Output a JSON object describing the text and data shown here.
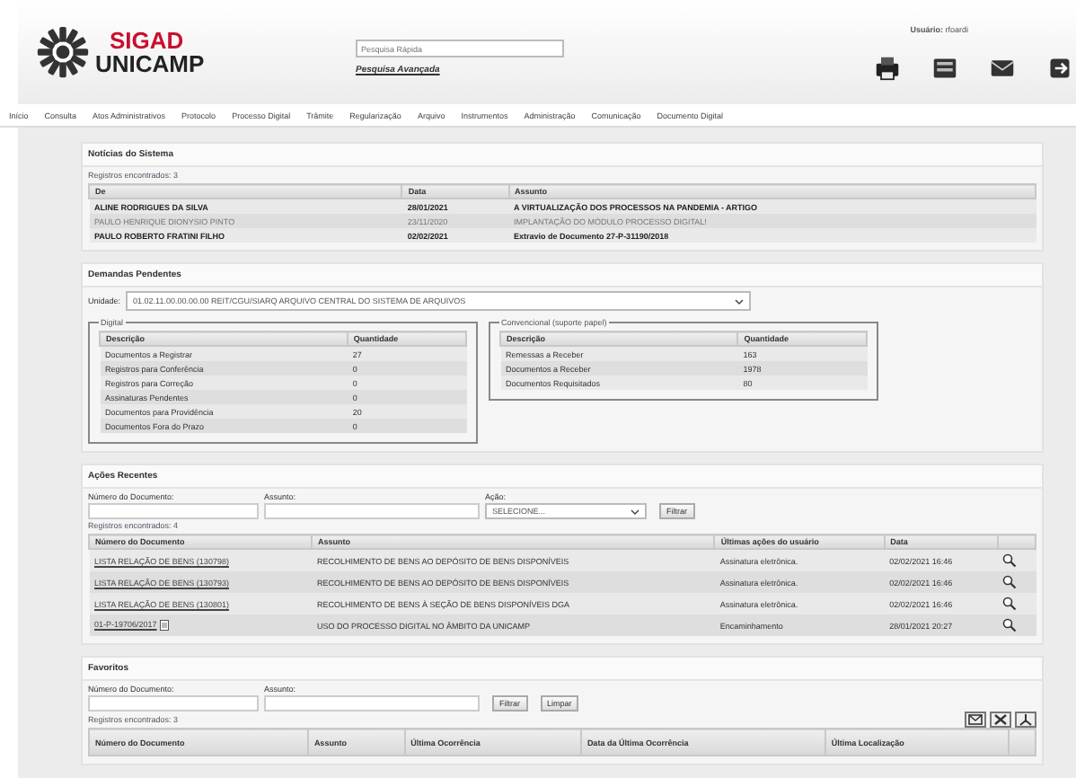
{
  "header": {
    "logo_top": "SIGAD",
    "logo_bottom": "UNICAMP",
    "search": {
      "placeholder": "Pesquisa Rápida"
    },
    "advanced_link": "Pesquisa Avançada",
    "user_label": "Usuário:",
    "user_value": "rfoardi"
  },
  "nav": [
    {
      "label": "Início"
    },
    {
      "label": "Consulta"
    },
    {
      "label": "Atos Administrativos"
    },
    {
      "label": "Protocolo"
    },
    {
      "label": "Processo Digital"
    },
    {
      "label": "Trâmite"
    },
    {
      "label": "Regularização"
    },
    {
      "label": "Arquivo"
    },
    {
      "label": "Instrumentos"
    },
    {
      "label": "Administração"
    },
    {
      "label": "Comunicação"
    },
    {
      "label": "Documento Digital"
    }
  ],
  "news": {
    "title": "Notícias do Sistema",
    "count": "Registros encontrados: 3",
    "columns": [
      "De",
      "Data",
      "Assunto"
    ],
    "rows": [
      {
        "cells": [
          "ALINE RODRIGUES DA SILVA",
          "28/01/2021",
          "A VIRTUALIZAÇÃO DOS PROCESSOS NA PANDEMIA - ARTIGO"
        ],
        "unread": true
      },
      {
        "cells": [
          "PAULO HENRIQUE DIONYSIO PINTO",
          "23/11/2020",
          "IMPLANTAÇÃO DO MÓDULO PROCESSO DIGITAL!"
        ],
        "unread": false
      },
      {
        "cells": [
          "PAULO ROBERTO FRATINI FILHO",
          "02/02/2021",
          "Extravio de Documento 27-P-31190/2018"
        ],
        "unread": true
      }
    ]
  },
  "pending": {
    "title": "Demandas Pendentes",
    "unit_label": "Unidade:",
    "unit_value": "01.02.11.00.00.00.00 REIT/CGU/SIARQ ARQUIVO CENTRAL DO SISTEMA DE ARQUIVOS",
    "groups": [
      {
        "legend": "Digital",
        "columns": [
          "Descrição",
          "Quantidade"
        ],
        "rows": [
          [
            "Documentos a Registrar",
            "27"
          ],
          [
            "Registros para Conferência",
            "0"
          ],
          [
            "Registros para Correção",
            "0"
          ],
          [
            "Assinaturas Pendentes",
            "0"
          ],
          [
            "Documentos para Providência",
            "20"
          ],
          [
            "Documentos Fora do Prazo",
            "0"
          ]
        ]
      },
      {
        "legend": "Convencional (suporte papel)",
        "columns": [
          "Descrição",
          "Quantidade"
        ],
        "rows": [
          [
            "Remessas a Receber",
            "163"
          ],
          [
            "Documentos a Receber",
            "1978"
          ],
          [
            "Documentos Requisitados",
            "80"
          ]
        ]
      }
    ]
  },
  "recent": {
    "title": "Ações Recentes",
    "filters": [
      {
        "label": "Número do Documento:",
        "kind": "text"
      },
      {
        "label": "Assunto:",
        "kind": "text"
      },
      {
        "label": "Ação:",
        "kind": "select",
        "value": "SELECIONE..."
      }
    ],
    "buttons": [
      "Filtrar"
    ],
    "count": "Registros encontrados: 4",
    "columns": [
      "Número do Documento",
      "Assunto",
      "Últimas ações do usuário",
      "Data"
    ],
    "rows": [
      {
        "cells": [
          "LISTA RELAÇÃO DE BENS (130798)",
          "RECOLHIMENTO DE BENS AO DEPÓSITO DE BENS DISPONÍVEIS",
          "Assinatura eletrônica.",
          "02/02/2021 16:46"
        ],
        "doc_icon": false
      },
      {
        "cells": [
          "LISTA RELAÇÃO DE BENS (130793)",
          "RECOLHIMENTO DE BENS AO DEPÓSITO DE BENS DISPONÍVEIS",
          "Assinatura eletrônica.",
          "02/02/2021 16:46"
        ],
        "doc_icon": false
      },
      {
        "cells": [
          "LISTA RELAÇÃO DE BENS (130801)",
          "RECOLHIMENTO DE BENS À SEÇÃO DE BENS DISPONÍVEIS DGA",
          "Assinatura eletrônica.",
          "02/02/2021 16:46"
        ],
        "doc_icon": false
      },
      {
        "cells": [
          "01-P-19706/2017",
          "USO DO PROCESSO DIGITAL NO ÂMBITO DA UNICAMP",
          "Encaminhamento",
          "28/01/2021 20:27"
        ],
        "doc_icon": true
      }
    ]
  },
  "favorites": {
    "title": "Favoritos",
    "filters": [
      {
        "label": "Número do Documento:",
        "kind": "text"
      },
      {
        "label": "Assunto:",
        "kind": "text"
      }
    ],
    "buttons": [
      "Filtrar",
      "Limpar"
    ],
    "count": "Registros encontrados: 3",
    "columns": [
      "Número do Documento",
      "Assunto",
      "Última Ocorrência",
      "Data da Última Ocorrência",
      "Última Localização"
    ]
  }
}
